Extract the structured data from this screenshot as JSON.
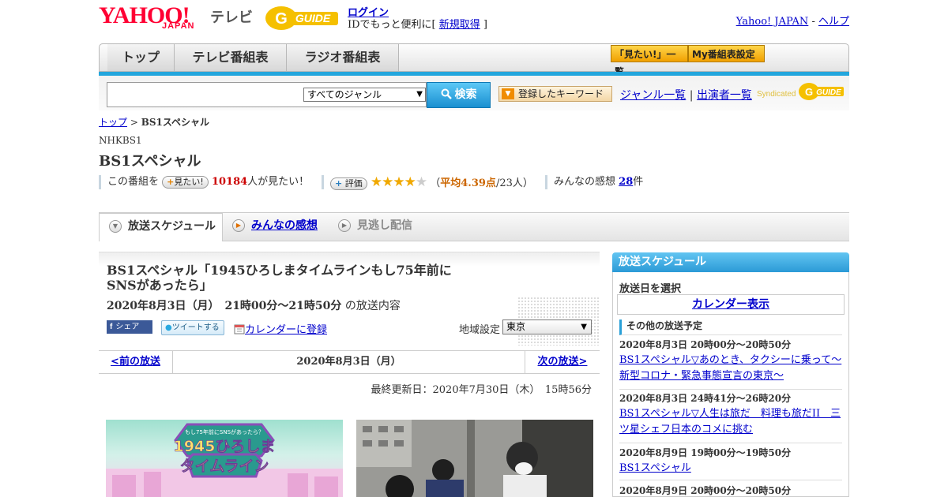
{
  "header": {
    "logo_text": "YAHOO!",
    "logo_sub": "JAPAN",
    "service_name": "テレビ",
    "gguide_text": "GUIDE",
    "login_label": "ログイン",
    "login_sub_pre": "IDでもっと便利に[ ",
    "signup_label": "新規取得",
    "login_sub_post": " ]",
    "yahoo_japan_link": "Yahoo! JAPAN",
    "sep": " - ",
    "help_link": "ヘルプ"
  },
  "nav": {
    "tabs": [
      "トップ",
      "テレビ番組表",
      "ラジオ番組表"
    ],
    "mitai_button": "「見たい!」一覧",
    "my_bangumi_button": "My番組表設定"
  },
  "search": {
    "placeholder": "",
    "genre_selected": "すべてのジャンル",
    "search_button": "検索",
    "keyword_button": "登録したキーワード",
    "genre_list_link": "ジャンル一覧",
    "link_sep": " | ",
    "performer_list_link": "出演者一覧",
    "syndicated_text": "Syndicated",
    "syndicated_logo": "GUIDE"
  },
  "breadcrumb": {
    "top_link": "トップ",
    "sep": " > ",
    "current": "BS1スペシャル"
  },
  "program": {
    "channel": "NHKBS1",
    "title": "BS1スペシャル",
    "watch_prefix": "この番組を",
    "watch_pill": "見たい!",
    "watch_count": "10184",
    "watch_suffix": "人が見たい！",
    "rating_pill": "評価",
    "rating_value": 4.39,
    "rating_text_pre": "（",
    "rating_text_avg": "平均4.39点",
    "rating_text_post": "/23人）",
    "reviews_prefix": "みんなの感想",
    "reviews_count": "28",
    "reviews_suffix": "件"
  },
  "tabs": {
    "schedule": "放送スケジュール",
    "reviews": "みんなの感想",
    "missed": "見逃し配信"
  },
  "episode": {
    "title": "BS1スペシャル「1945ひろしまタイムラインもし75年前にSNSがあったら」",
    "date": "2020年8月3日（月）　21時00分～21時50分",
    "date_suffix": "の放送内容",
    "share_facebook": "シェア",
    "share_twitter": "ツイートする",
    "calendar_link": "カレンダーに登録",
    "region_label": "地域設定",
    "region_value": "東京"
  },
  "pager": {
    "prev": "<前の放送",
    "current": "2020年8月3日（月）",
    "next": "次の放送>"
  },
  "updated": "最終更新日：2020年7月30日（木）　15時56分",
  "sidebar": {
    "header": "放送スケジュール",
    "select_date": "放送日を選択",
    "calendar_button": "カレンダー表示",
    "other_header": "その他の放送予定",
    "schedules": [
      {
        "time": "2020年8月3日 20時00分～20時50分",
        "title": "BS1スペシャル▽あのとき、タクシーに乗って～新型コロナ・緊急事態宣言の東京～"
      },
      {
        "time": "2020年8月3日 24時41分～26時20分",
        "title": "BS1スペシャル▽人生は旅だ　料理も旅だII　三ツ星シェフ日本のコメに挑む"
      },
      {
        "time": "2020年8月9日 19時00分～19時50分",
        "title": "BS1スペシャル"
      },
      {
        "time": "2020年8月9日 20時00分～20時50分",
        "title": ""
      }
    ]
  },
  "images": {
    "img1_top": "もし75年前にSNSがあったら？",
    "img1_title1": "1945ひろしま",
    "img1_title2": "タイムライン"
  },
  "colors": {
    "accent_blue": "#23a6dd",
    "link": "#0000cc",
    "brand_red": "#ff0033",
    "star": "#f0a800"
  }
}
